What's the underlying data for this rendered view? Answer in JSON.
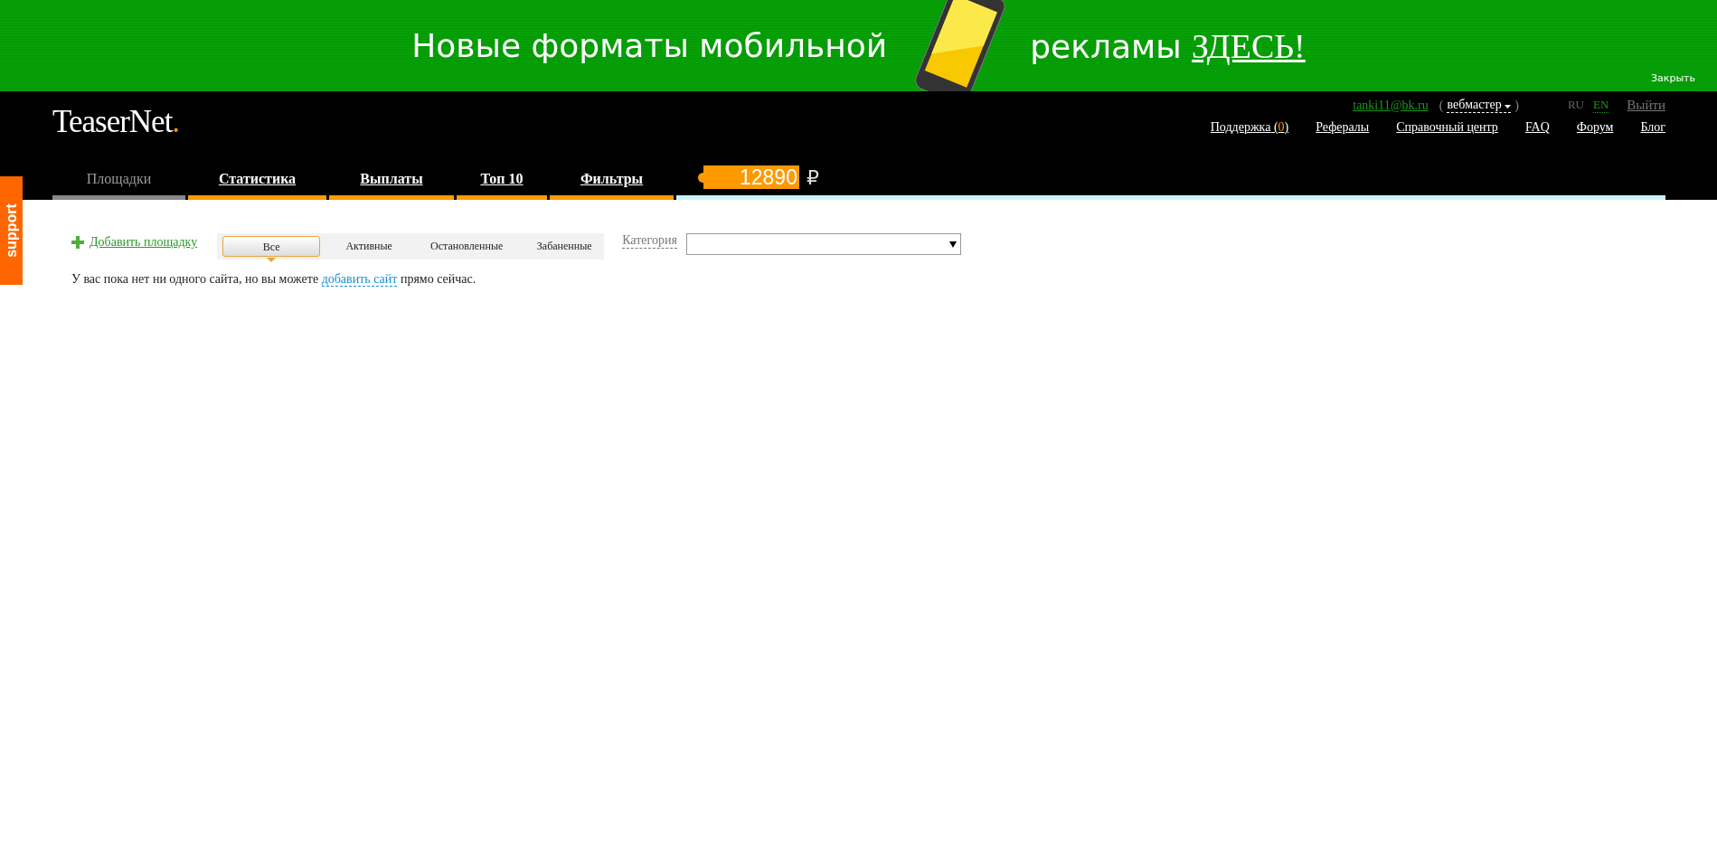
{
  "banner": {
    "text": "Новые форматы мобильной",
    "text_after": "рекламы",
    "link": "ЗДЕСЬ!",
    "close": "Закрыть"
  },
  "support_tab": "support",
  "header": {
    "logo": "TeaserNet",
    "logo_dot": ".",
    "email": "tanki11@bk.ru",
    "role_open": "(",
    "role": "вебмастер",
    "role_close": ")",
    "languages": [
      {
        "label": "RU",
        "selected": true
      },
      {
        "label": "EN",
        "selected": false
      }
    ],
    "logout": "Выйти",
    "links": [
      {
        "label": "Поддержка",
        "count_open": "(",
        "count": "0",
        "count_close": ")"
      },
      {
        "label": "Рефералы"
      },
      {
        "label": "Справочный центр"
      },
      {
        "label": "FAQ"
      },
      {
        "label": "Форум"
      },
      {
        "label": "Блог"
      }
    ],
    "nav": [
      {
        "label": "Площадки",
        "selected": true
      },
      {
        "label": "Статистика",
        "selected": false
      },
      {
        "label": "Выплаты",
        "selected": false
      },
      {
        "label": "Топ 10",
        "selected": false
      },
      {
        "label": "Фильтры",
        "selected": false
      }
    ],
    "balance": "12890",
    "currency": "₽"
  },
  "content": {
    "add_site": "Добавить площадку",
    "filters": [
      {
        "label": "Все",
        "selected": true
      },
      {
        "label": "Активные",
        "selected": false
      },
      {
        "label": "Остановленные",
        "selected": false
      },
      {
        "label": "Забаненные",
        "selected": false
      }
    ],
    "category_label": "Категория",
    "message": "У вас пока нет ни одного сайта, но вы можете",
    "message_link": "добавить сайт",
    "message_end": "прямо сейчас."
  }
}
